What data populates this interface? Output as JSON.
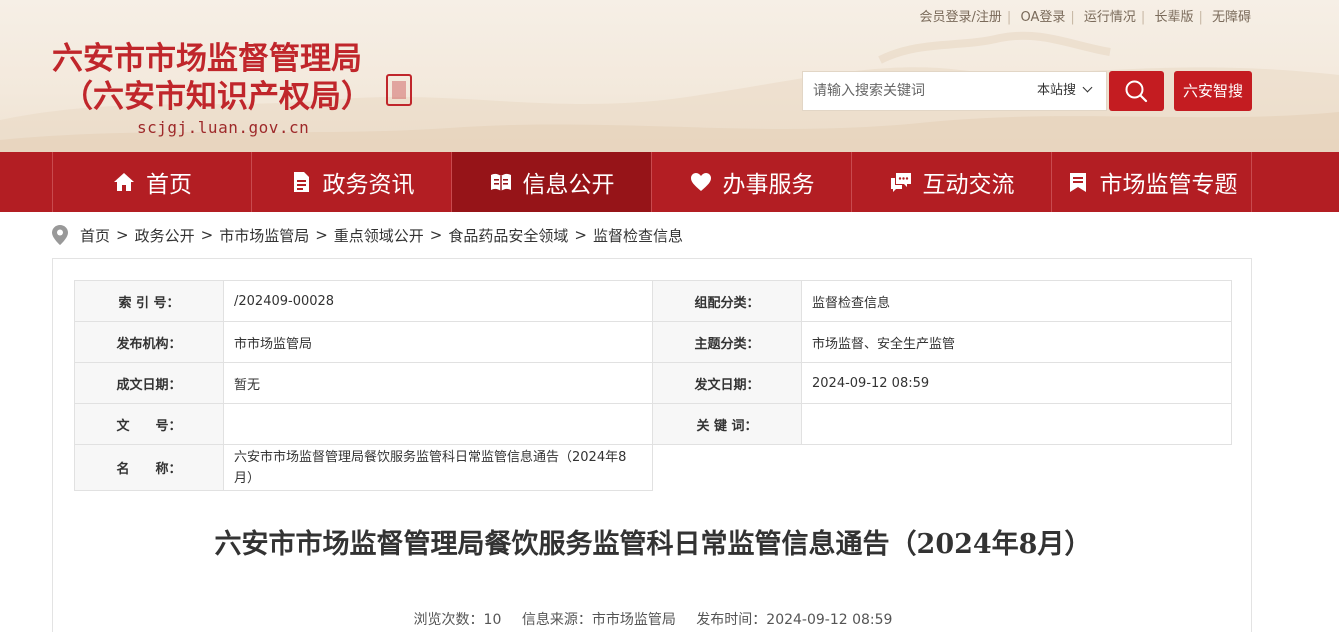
{
  "top_links": [
    "会员登录/注册",
    "OA登录",
    "运行情况",
    "长辈版",
    "无障碍"
  ],
  "site": {
    "title_line1": "六安市市场监督管理局",
    "title_line2": "（六安市知识产权局）",
    "domain": "scjgj.luan.gov.cn"
  },
  "search": {
    "placeholder": "请输入搜索关键词",
    "scope": "本站搜",
    "smart_label": "六安智搜"
  },
  "nav": [
    {
      "label": "首页",
      "icon": "home-icon"
    },
    {
      "label": "政务资讯",
      "icon": "document-icon"
    },
    {
      "label": "信息公开",
      "icon": "open-book-icon"
    },
    {
      "label": "办事服务",
      "icon": "heart-icon"
    },
    {
      "label": "互动交流",
      "icon": "chat-icon"
    },
    {
      "label": "市场监管专题",
      "icon": "bookmark-icon"
    }
  ],
  "nav_active_index": 2,
  "breadcrumb": [
    "首页",
    "政务公开",
    "市市场监管局",
    "重点领域公开",
    "食品药品安全领域",
    "监督检查信息"
  ],
  "meta": {
    "index_label": "索 引 号：",
    "index_value": "/202409-00028",
    "category_label": "组配分类：",
    "category_value": "监督检查信息",
    "publisher_label": "发布机构：",
    "publisher_value": "市市场监管局",
    "topic_label": "主题分类：",
    "topic_value": "市场监督、安全生产监管",
    "created_label": "成文日期：",
    "created_value": "暂无",
    "issued_label": "发文日期：",
    "issued_value": "2024-09-12 08:59",
    "docno_label": "文　　号：",
    "docno_value": "",
    "keywords_label": "关 键 词：",
    "keywords_value": "",
    "name_label": "名　　称：",
    "name_value": "六安市市场监督管理局餐饮服务监管科日常监管信息通告（2024年8月）"
  },
  "article": {
    "title": "六安市市场监督管理局餐饮服务监管科日常监管信息通告（2024年8月）",
    "views": "浏览次数：10",
    "source": "信息来源：市市场监管局",
    "published": "发布时间：2024-09-12 08:59"
  }
}
